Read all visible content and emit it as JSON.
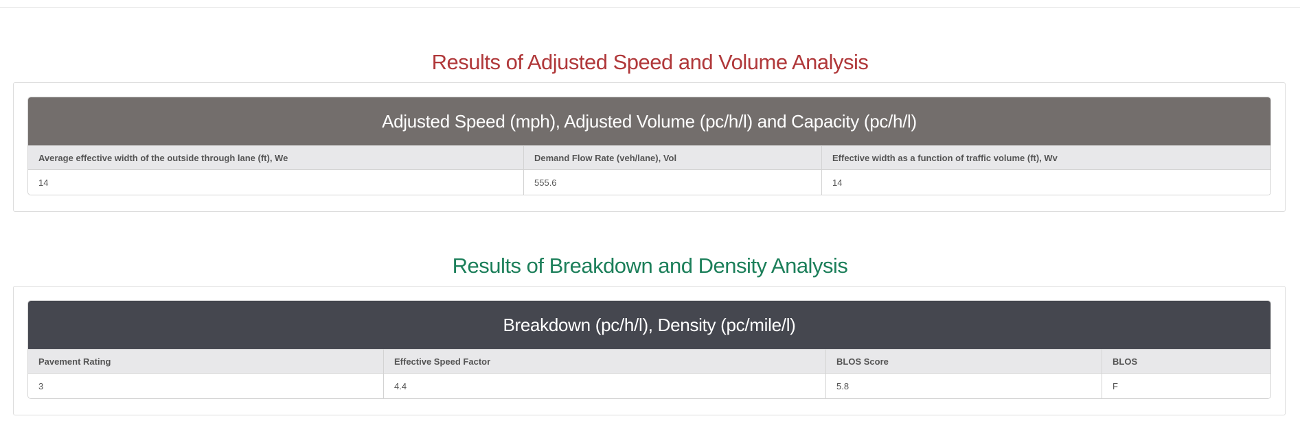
{
  "sections": [
    {
      "title": "Results of Adjusted Speed and Volume Analysis",
      "table_heading": "Adjusted Speed (mph), Adjusted Volume (pc/h/l) and Capacity (pc/h/l)",
      "columns": [
        "Average effective width of the outside through lane (ft), We",
        "Demand Flow Rate (veh/lane), Vol",
        "Effective width as a function of traffic volume (ft), Wv"
      ],
      "values": [
        "14",
        "555.6",
        "14"
      ]
    },
    {
      "title": "Results of Breakdown and Density Analysis",
      "table_heading": "Breakdown (pc/h/l), Density (pc/mile/l)",
      "columns": [
        "Pavement Rating",
        "Effective Speed Factor",
        "BLOS Score",
        "BLOS"
      ],
      "values": [
        "3",
        "4.4",
        "5.8",
        "F"
      ]
    }
  ],
  "colors": {
    "title_1": "#b0383a",
    "title_2": "#1c7f5a",
    "heading_1_bg": "#736e6c",
    "heading_2_bg": "#45474f"
  }
}
